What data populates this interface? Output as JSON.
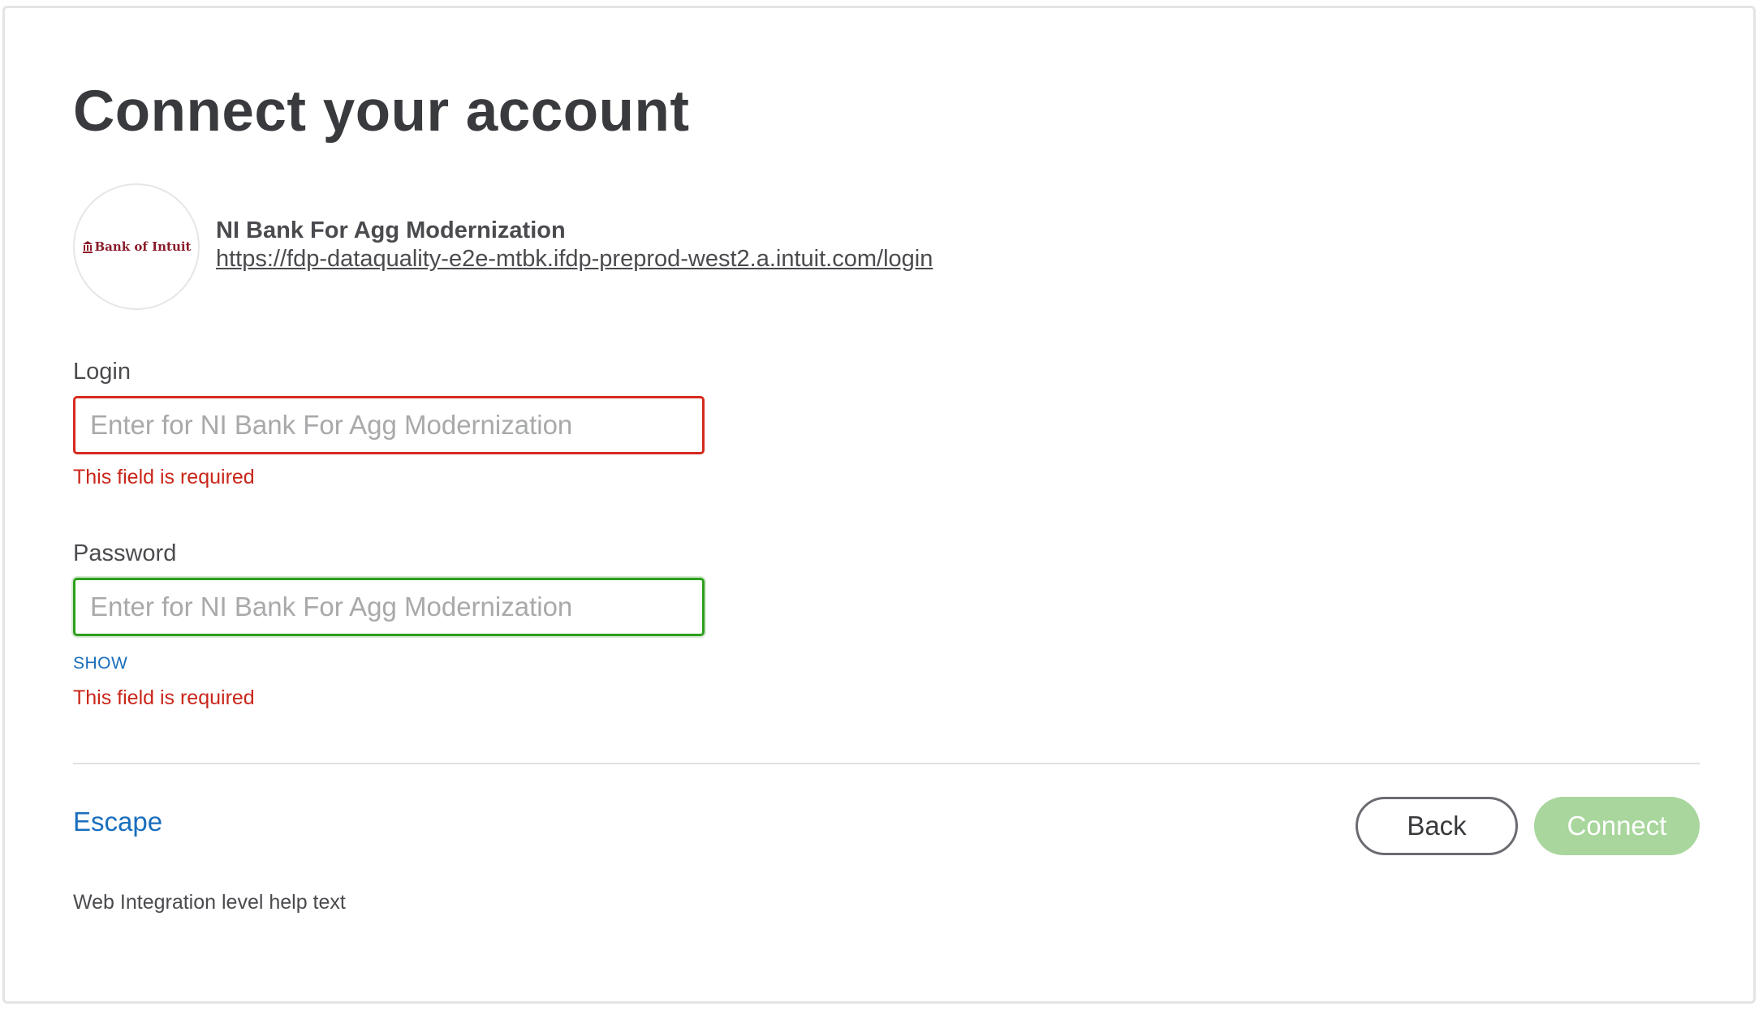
{
  "page": {
    "title": "Connect your account"
  },
  "institution": {
    "logo_text": "Bank of Intuit",
    "name": "NI Bank For Agg Modernization",
    "url": "https://fdp-dataquality-e2e-mtbk.ifdp-preprod-west2.a.intuit.com/login"
  },
  "form": {
    "login": {
      "label": "Login",
      "value": "",
      "placeholder": "Enter for NI Bank For Agg Modernization",
      "error": "This field is required"
    },
    "password": {
      "label": "Password",
      "value": "",
      "placeholder": "Enter for NI Bank For Agg Modernization",
      "show_label": "SHOW",
      "error": "This field is required"
    }
  },
  "footer": {
    "escape_label": "Escape",
    "back_label": "Back",
    "connect_label": "Connect",
    "help_text": "Web Integration level help text"
  },
  "colors": {
    "title": "#393a3d",
    "error": "#d52b1e",
    "focus": "#2ca01c",
    "link": "#1a6ebd",
    "connect_disabled": "#a8d69c",
    "logo": "#8a1c2b"
  },
  "icons": {
    "logo_icon": "bank-pillar-icon"
  }
}
